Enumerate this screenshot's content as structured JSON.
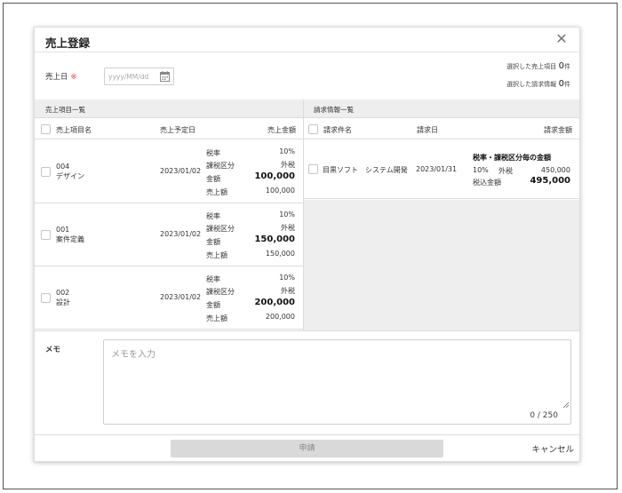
{
  "dialog": {
    "title": "売上登録",
    "close_icon": "close-icon"
  },
  "sales_date": {
    "label": "売上日",
    "required_mark": "※",
    "placeholder": "yyyy/MM/dd"
  },
  "summary": {
    "selected_items_label": "選択した売上項目",
    "selected_items_count": "0",
    "selected_items_unit": "件",
    "selected_invoices_label": "選択した請求情報",
    "selected_invoices_count": "0",
    "selected_invoices_unit": "件"
  },
  "sales_items": {
    "section_title": "売上項目一覧",
    "columns": {
      "name": "売上項目名",
      "scheduled_date": "売上予定日",
      "amount": "売上金額"
    },
    "rows": [
      {
        "code": "004",
        "name": "デザイン",
        "date": "2023/01/02",
        "tax_rate_label": "税率",
        "tax_rate": "10%",
        "tax_type_label": "課税区分",
        "tax_type": "外税",
        "amount_label": "金額",
        "amount": "100,000",
        "sales_label": "売上額",
        "sales": "100,000"
      },
      {
        "code": "001",
        "name": "案件定義",
        "date": "2023/01/02",
        "tax_rate_label": "税率",
        "tax_rate": "10%",
        "tax_type_label": "課税区分",
        "tax_type": "外税",
        "amount_label": "金額",
        "amount": "150,000",
        "sales_label": "売上額",
        "sales": "150,000"
      },
      {
        "code": "002",
        "name": "設計",
        "date": "2023/01/02",
        "tax_rate_label": "税率",
        "tax_rate": "10%",
        "tax_type_label": "課税区分",
        "tax_type": "外税",
        "amount_label": "金額",
        "amount": "200,000",
        "sales_label": "売上額",
        "sales": "200,000"
      }
    ]
  },
  "invoices": {
    "section_title": "請求情報一覧",
    "columns": {
      "name": "請求件名",
      "date": "請求日",
      "amount": "請求金額"
    },
    "rows": [
      {
        "name": "目黒ソフト　システム開発",
        "date": "2023/01/31",
        "breakdown_title": "税率・課税区分毎の金額",
        "tax_rate": "10%",
        "tax_type": "外税",
        "subtotal": "450,000",
        "total_label": "税込金額",
        "total": "495,000"
      }
    ]
  },
  "memo": {
    "label": "メモ",
    "placeholder": "メモを入力",
    "counter": "0 / 250"
  },
  "footer": {
    "apply_label": "申請",
    "cancel_label": "キャンセル"
  }
}
